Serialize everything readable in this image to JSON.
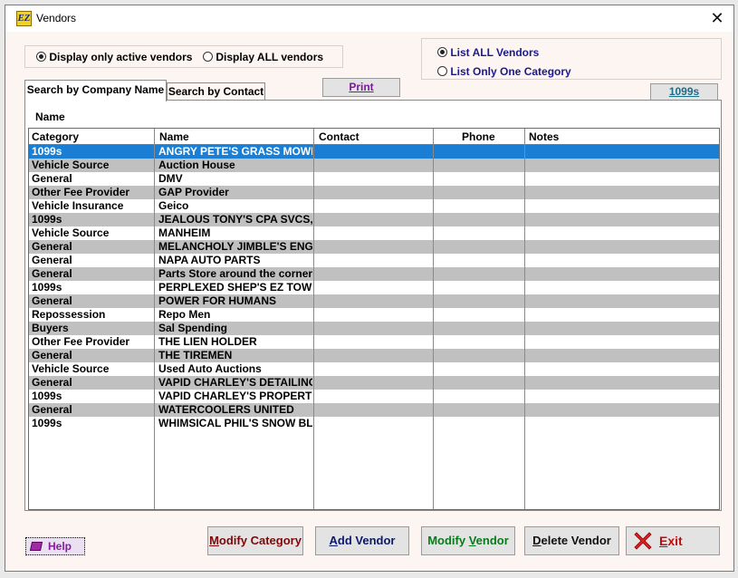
{
  "window": {
    "title": "Vendors",
    "icon": "ez-app-icon",
    "close": "✕"
  },
  "filter": {
    "active_label": "Display only active vendors",
    "all_label": "Display ALL vendors",
    "selected": "active"
  },
  "category_mode": {
    "all_label": "List ALL Vendors",
    "one_label": "List Only One Category",
    "selected": "all"
  },
  "tabs": [
    {
      "label": "Search by Company Name",
      "active": true
    },
    {
      "label": "Search by Contact",
      "active": false
    }
  ],
  "print_button": "Print",
  "btn_1099": "1099s",
  "panel": {
    "name_label": "Name"
  },
  "table": {
    "columns": [
      "Category",
      "Name",
      "Contact",
      "Phone",
      "Notes"
    ],
    "rows": [
      [
        "1099s",
        "ANGRY PETE'S GRASS MOWING",
        "",
        "",
        ""
      ],
      [
        "Vehicle Source",
        "Auction House",
        "",
        "",
        ""
      ],
      [
        "General",
        "DMV",
        "",
        "",
        ""
      ],
      [
        "Other Fee Provider",
        "GAP Provider",
        "",
        "",
        ""
      ],
      [
        "Vehicle Insurance",
        "Geico",
        "",
        "",
        ""
      ],
      [
        "1099s",
        "JEALOUS TONY'S CPA SVCS, LLC",
        "",
        "",
        ""
      ],
      [
        "Vehicle Source",
        "MANHEIM",
        "",
        "",
        ""
      ],
      [
        "General",
        "MELANCHOLY JIMBLE'S ENGINE",
        "",
        "",
        ""
      ],
      [
        "General",
        "NAPA AUTO PARTS",
        "",
        "",
        ""
      ],
      [
        "General",
        "Parts Store around the corner",
        "",
        "",
        ""
      ],
      [
        "1099s",
        "PERPLEXED SHEP'S EZ TOWING",
        "",
        "",
        ""
      ],
      [
        "General",
        "POWER FOR HUMANS",
        "",
        "",
        ""
      ],
      [
        "Repossession",
        "Repo Men",
        "",
        "",
        ""
      ],
      [
        "Buyers",
        "Sal Spending",
        "",
        "",
        ""
      ],
      [
        "Other Fee Provider",
        "THE LIEN HOLDER",
        "",
        "",
        ""
      ],
      [
        "General",
        "THE TIREMEN",
        "",
        "",
        ""
      ],
      [
        "Vehicle Source",
        "Used Auto Auctions",
        "",
        "",
        ""
      ],
      [
        "General",
        "VAPID CHARLEY'S DETAILING",
        "",
        "",
        ""
      ],
      [
        "1099s",
        "VAPID CHARLEY'S PROPERTY MGMT",
        "",
        "",
        ""
      ],
      [
        "General",
        "WATERCOOLERS UNITED",
        "",
        "",
        ""
      ],
      [
        "1099s",
        "WHIMSICAL PHIL'S SNOW BLOWING",
        "",
        "",
        ""
      ]
    ],
    "selected_row": 0
  },
  "buttons": {
    "help": {
      "label": "Help",
      "icon": "book-icon"
    },
    "modify_category": {
      "prefix": "M",
      "rest": "odify Category",
      "color": "#7a0a0a"
    },
    "add_vendor": {
      "prefix": "A",
      "rest": "dd Vendor",
      "color": "#0a1a6a"
    },
    "modify_vendor": {
      "pre": "Modify ",
      "prefix": "V",
      "rest": "endor",
      "color": "#0a7a1a"
    },
    "delete_vendor": {
      "prefix": "D",
      "rest": "elete Vendor",
      "color": "#111111"
    },
    "exit": {
      "prefix": "E",
      "rest": "xit",
      "color": "#c40a0a",
      "icon": "red-x-icon"
    }
  }
}
